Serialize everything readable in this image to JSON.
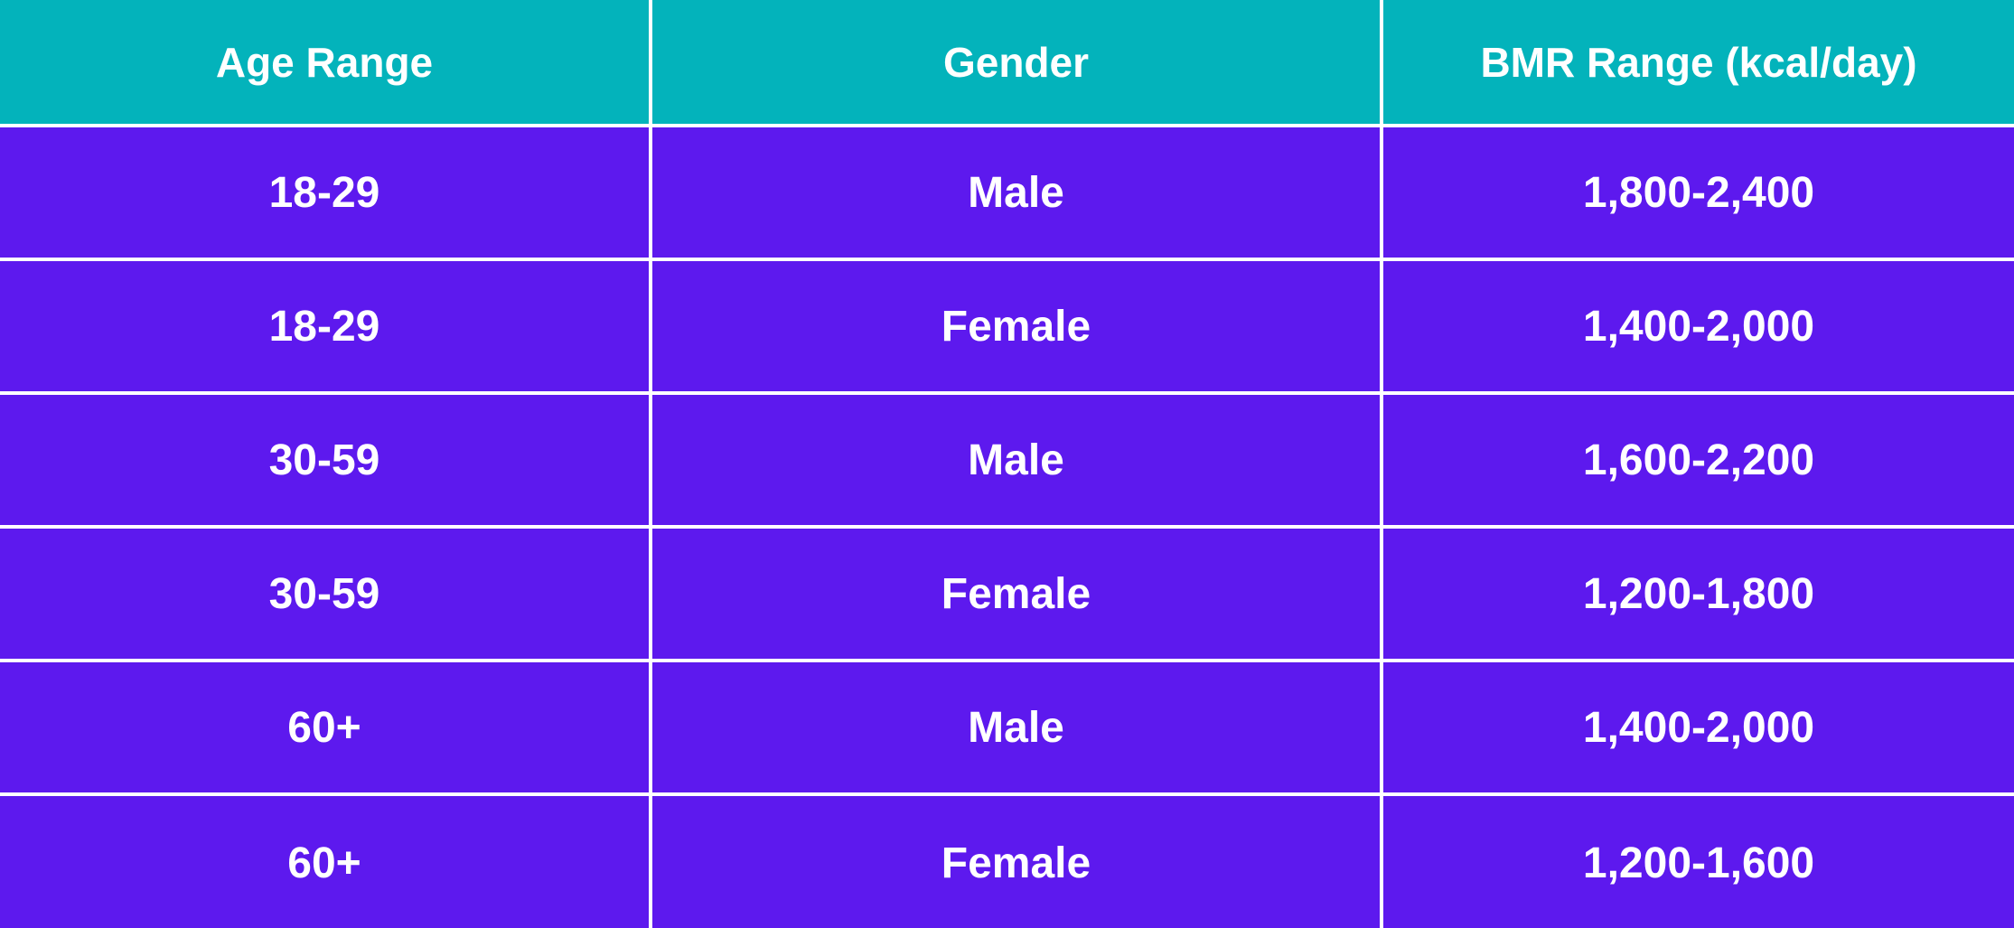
{
  "colors": {
    "header_bg": "#03B3BB",
    "row_bg": "#5D19EE",
    "text": "#FFFFFF",
    "grid_lines": "#FFFFFF"
  },
  "table": {
    "headers": [
      "Age Range",
      "Gender",
      "BMR Range (kcal/day)"
    ],
    "rows": [
      [
        "18-29",
        "Male",
        "1,800-2,400"
      ],
      [
        "18-29",
        "Female",
        "1,400-2,000"
      ],
      [
        "30-59",
        "Male",
        "1,600-2,200"
      ],
      [
        "30-59",
        "Female",
        "1,200-1,800"
      ],
      [
        "60+",
        "Male",
        "1,400-2,000"
      ],
      [
        "60+",
        "Female",
        "1,200-1,600"
      ]
    ]
  }
}
